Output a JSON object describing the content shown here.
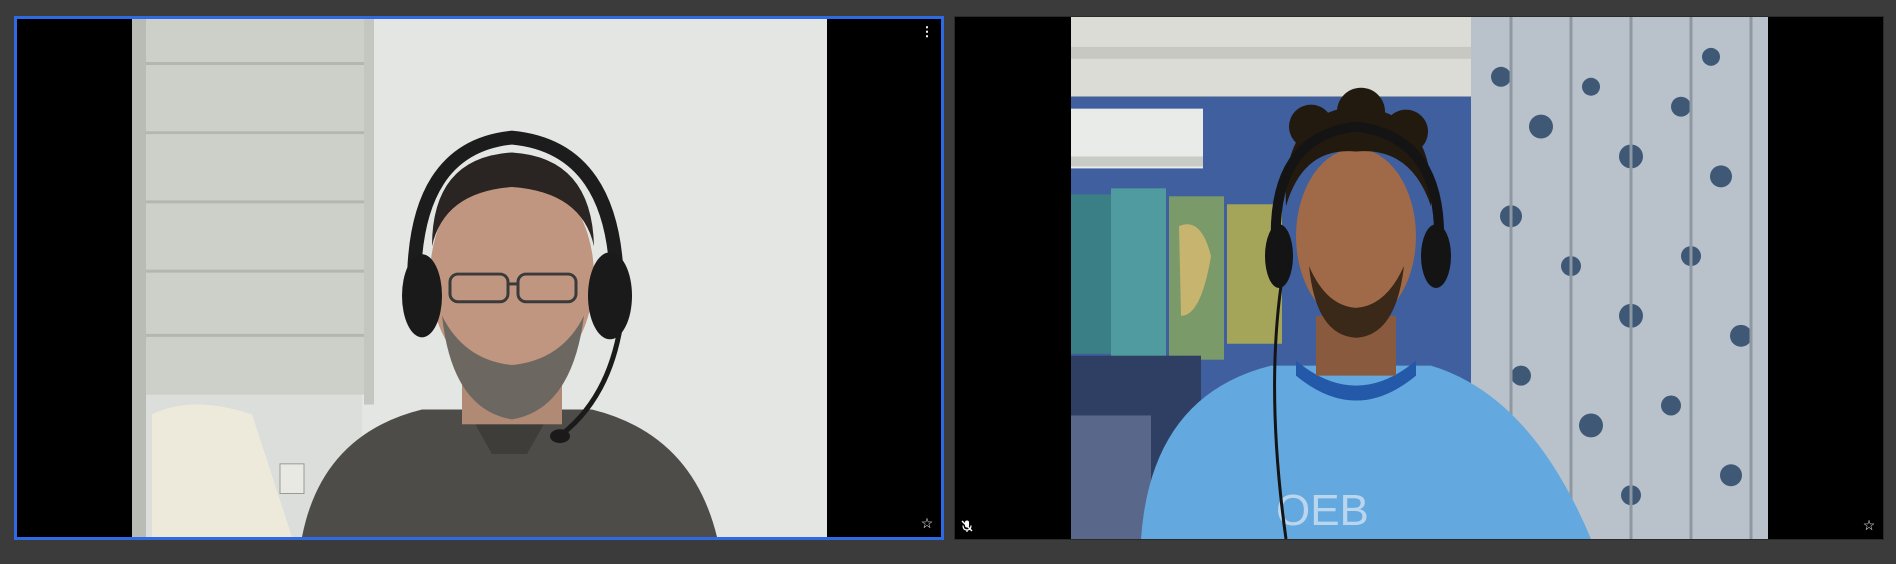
{
  "participants": [
    {
      "id": "left",
      "active_speaker": true,
      "menu_icon": "more-vertical-icon",
      "pin_icon": "star-icon",
      "muted": false
    },
    {
      "id": "right",
      "active_speaker": false,
      "pin_icon": "star-icon",
      "muted": true,
      "mute_icon": "mic-off-icon"
    }
  ],
  "colors": {
    "background": "#3b3b3b",
    "active_border": "#2d6ae3",
    "letterbox": "#000000"
  }
}
